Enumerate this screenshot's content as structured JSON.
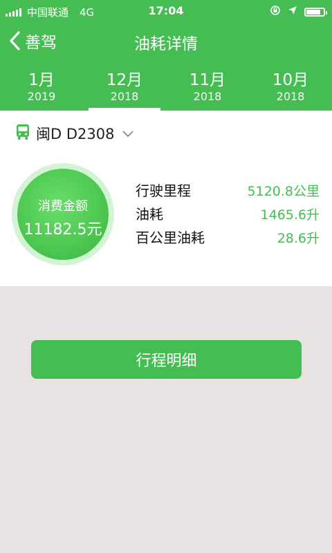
{
  "status_bar": {
    "carrier": "中国联通",
    "network": "4G",
    "time": "17:04",
    "battery_level": 0.85
  },
  "nav": {
    "back_label": "善驾",
    "title": "油耗详情"
  },
  "tabs": [
    {
      "month": "1月",
      "year": "2019",
      "active": false
    },
    {
      "month": "12月",
      "year": "2018",
      "active": true
    },
    {
      "month": "11月",
      "year": "2018",
      "active": false
    },
    {
      "month": "10月",
      "year": "2018",
      "active": false
    }
  ],
  "vehicle": {
    "plate": "闽D D2308",
    "icon": "bus-icon"
  },
  "summary": {
    "label": "消费金额",
    "value": "11182.5元"
  },
  "stats": [
    {
      "label": "行驶里程",
      "value": "5120.8公里"
    },
    {
      "label": "油耗",
      "value": "1465.6升"
    },
    {
      "label": "百公里油耗",
      "value": "28.6升"
    }
  ],
  "actions": {
    "trip_detail_label": "行程明细"
  },
  "colors": {
    "brand_green": "#45bd53",
    "background": "#e6e3e2"
  }
}
